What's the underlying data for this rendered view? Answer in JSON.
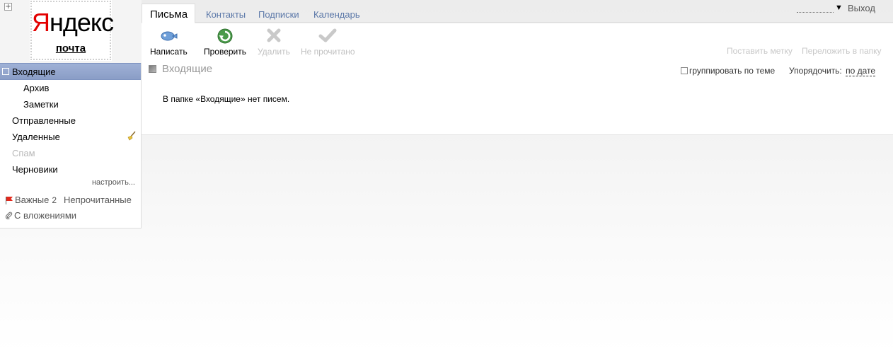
{
  "logo": {
    "brand_first": "Я",
    "brand_rest": "ндекс",
    "product": "почта"
  },
  "tabs": [
    {
      "label": "Письма",
      "active": true
    },
    {
      "label": "Контакты"
    },
    {
      "label": "Подписки"
    },
    {
      "label": "Календарь"
    }
  ],
  "account": {
    "logout_label": "Выход"
  },
  "toolbar": {
    "compose": "Написать",
    "check": "Проверить",
    "delete": "Удалить",
    "not_read": "Не прочитано",
    "set_label": "Поставить метку",
    "move_to_folder": "Переложить в папку"
  },
  "folders": [
    {
      "label": "Входящие",
      "active": true
    },
    {
      "label": "Архив",
      "sub": true
    },
    {
      "label": "Заметки",
      "sub": true
    },
    {
      "label": "Отправленные"
    },
    {
      "label": "Удаленные",
      "has_clean_icon": true
    },
    {
      "label": "Спам",
      "disabled": true
    },
    {
      "label": "Черновики"
    }
  ],
  "sidebar": {
    "settings_link": "настроить...",
    "important_label": "Важные",
    "important_count": "2",
    "unread_label": "Непрочитанные",
    "attachments_label": "С вложениями"
  },
  "main": {
    "folder_title": "Входящие",
    "group_by_thread": "группировать по теме",
    "sort_label": "Упорядочить:",
    "sort_value": "по дате",
    "empty_message": "В папке «Входящие» нет писем."
  },
  "colors": {
    "brand_red": "#e30000",
    "active_folder": "#8fa1c9",
    "tab_link": "#5a77a8"
  }
}
